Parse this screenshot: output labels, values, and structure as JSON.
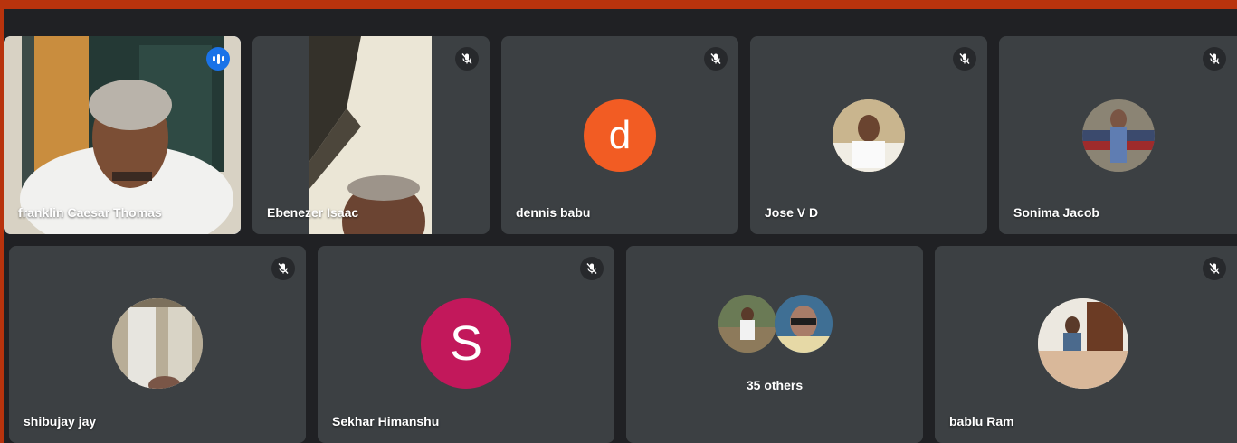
{
  "participants": [
    {
      "name": "franklin Caesar Thomas",
      "state": "speaking",
      "media": "video"
    },
    {
      "name": "Ebenezer Isaac",
      "state": "muted",
      "media": "video"
    },
    {
      "name": "dennis babu",
      "state": "muted",
      "media": "letter-avatar",
      "initial": "d",
      "color": "#f25c23"
    },
    {
      "name": "Jose V D",
      "state": "muted",
      "media": "photo-avatar"
    },
    {
      "name": "Sonima Jacob",
      "state": "muted",
      "media": "photo-avatar"
    },
    {
      "name": "shibujay jay",
      "state": "muted",
      "media": "photo-avatar"
    },
    {
      "name": "Sekhar Himanshu",
      "state": "muted",
      "media": "letter-avatar",
      "initial": "S",
      "color": "#c2185b"
    },
    {
      "name": "bablu Ram",
      "state": "muted",
      "media": "photo-avatar"
    }
  ],
  "others": {
    "label": "35 others"
  },
  "colors": {
    "background": "#202124",
    "tile": "#3c4043",
    "active_border": "#8ab4f8",
    "window_frame": "#b8330d"
  },
  "icons": {
    "muted": "mic-off-icon",
    "speaking": "audio-level-icon"
  }
}
